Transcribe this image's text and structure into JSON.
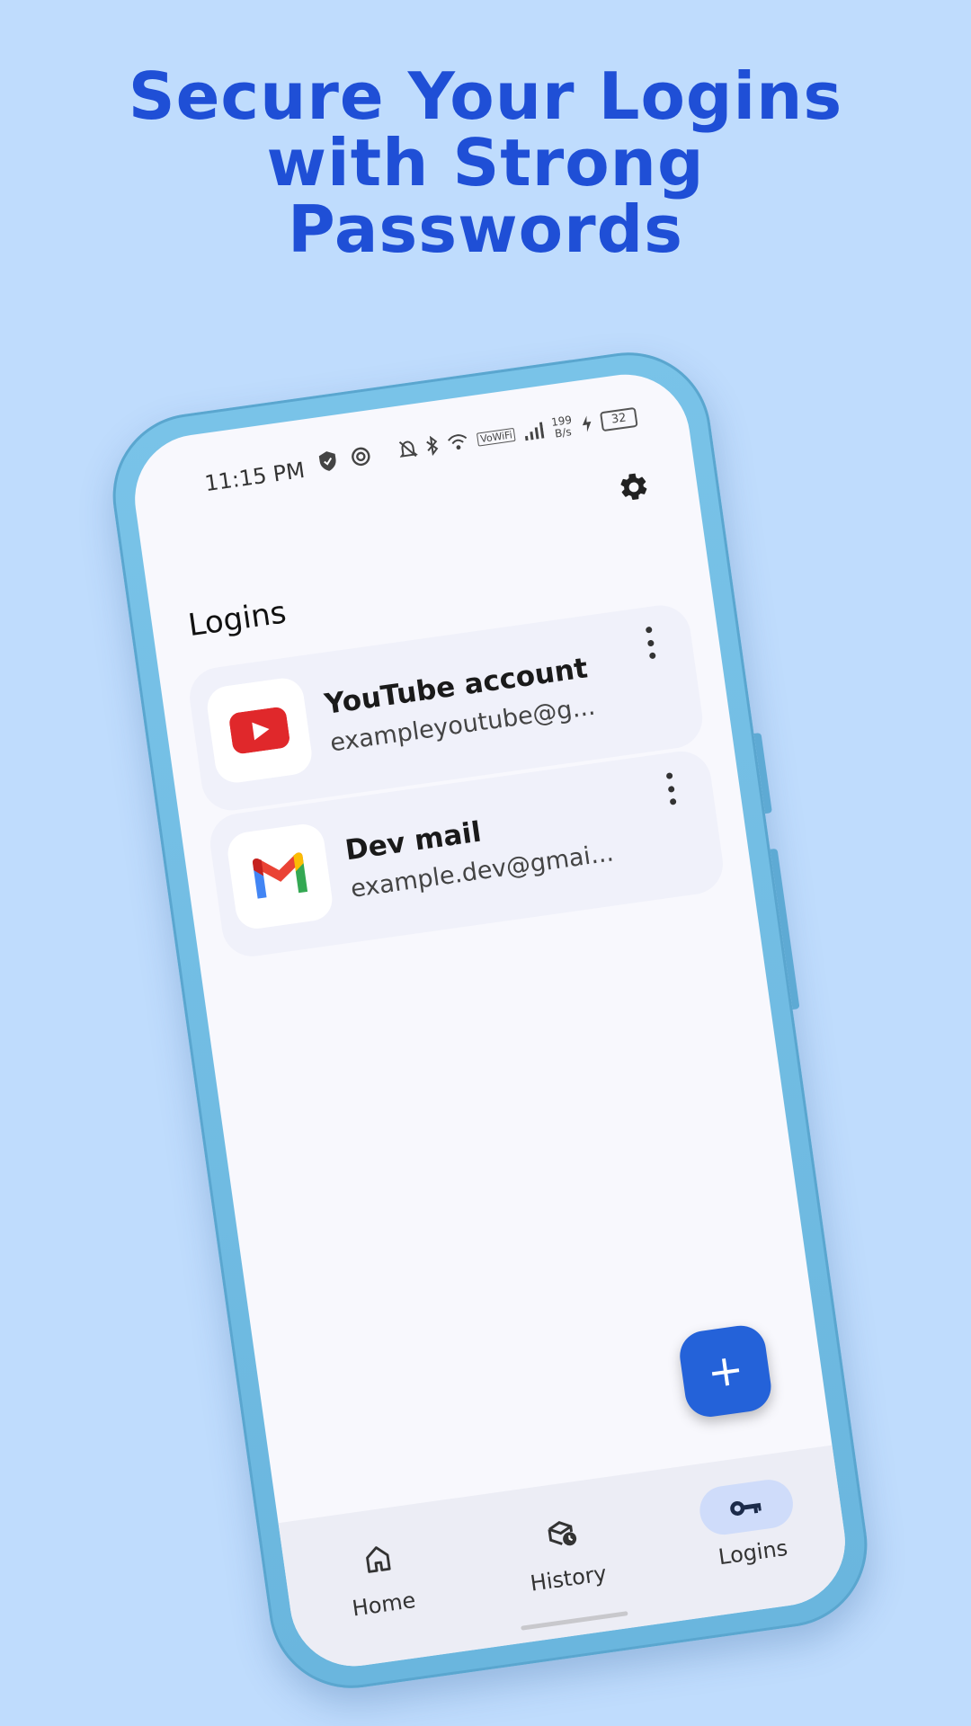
{
  "headline": {
    "line1": "Secure Your Logins",
    "line2": "with Strong",
    "line3": "Passwords"
  },
  "status_bar": {
    "time": "11:15 PM",
    "speed_value": "199",
    "speed_unit": "B/s",
    "battery": "32",
    "wifi_label": "VoWiFi"
  },
  "header": {
    "title": "Logins",
    "settings_icon": "gear-icon"
  },
  "logins": [
    {
      "title": "YouTube account",
      "subtitle": "exampleyoutube@g...",
      "icon": "youtube-icon"
    },
    {
      "title": "Dev mail",
      "subtitle": "example.dev@gmai...",
      "icon": "gmail-icon"
    }
  ],
  "fab": {
    "label": "+"
  },
  "nav": {
    "items": [
      {
        "label": "Home",
        "icon": "home-icon"
      },
      {
        "label": "History",
        "icon": "history-icon"
      },
      {
        "label": "Logins",
        "icon": "key-icon"
      }
    ],
    "active": "Logins"
  },
  "colors": {
    "background": "#bfdcfd",
    "headline": "#1f4fd6",
    "phone_frame": "#6ab6de",
    "accent": "#2462d9",
    "active_pill": "#cfdcfa"
  }
}
